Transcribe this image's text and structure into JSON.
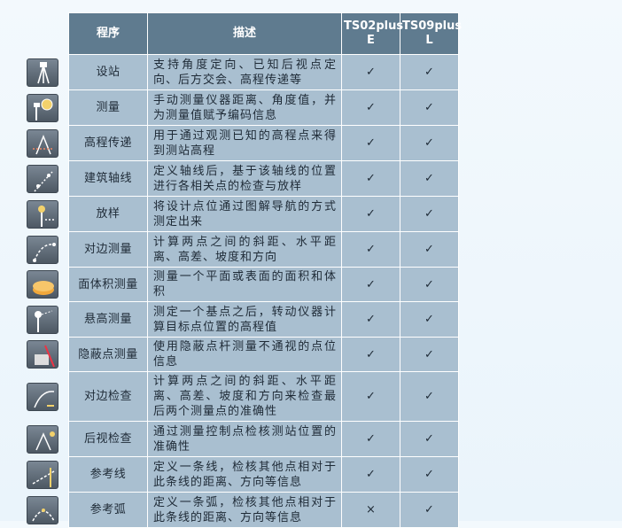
{
  "header": {
    "program": "程序",
    "description": "描述",
    "ts02": "TS02plus E",
    "ts09": "TS09plus L"
  },
  "rows": [
    {
      "name": "设站",
      "desc": "支持角度定向、已知后视点定向、后方交会、高程传递等",
      "ts02": "✓",
      "ts09": "✓",
      "icon": "total-station-setup-icon"
    },
    {
      "name": "测量",
      "desc": "手动测量仪器距离、角度值，并为测量值赋予编码信息",
      "ts02": "✓",
      "ts09": "✓",
      "icon": "survey-prism-icon"
    },
    {
      "name": "高程传递",
      "desc": "用于通过观测已知的高程点来得到测站高程",
      "ts02": "✓",
      "ts09": "✓",
      "icon": "height-transfer-icon"
    },
    {
      "name": "建筑轴线",
      "desc": "定义轴线后，基于该轴线的位置进行各相关点的检查与放样",
      "ts02": "✓",
      "ts09": "✓",
      "icon": "construction-axis-icon"
    },
    {
      "name": "放样",
      "desc": "将设计点位通过图解导航的方式测定出来",
      "ts02": "✓",
      "ts09": "✓",
      "icon": "stakeout-icon"
    },
    {
      "name": "对边测量",
      "desc": "计算两点之间的斜距、水平距离、高差、坡度和方向",
      "ts02": "✓",
      "ts09": "✓",
      "icon": "tie-distance-icon"
    },
    {
      "name": "面体积测量",
      "desc": "测量一个平面或表面的面积和体积",
      "ts02": "✓",
      "ts09": "✓",
      "icon": "area-volume-icon"
    },
    {
      "name": "悬高测量",
      "desc": "测定一个基点之后，转动仪器计算目标点位置的高程值",
      "ts02": "✓",
      "ts09": "✓",
      "icon": "remote-height-icon"
    },
    {
      "name": "隐蔽点测量",
      "desc": "使用隐蔽点杆测量不通视的点位信息",
      "ts02": "✓",
      "ts09": "✓",
      "icon": "hidden-point-icon"
    },
    {
      "name": "对边检查",
      "desc": "计算两点之间的斜距、水平距离、高差、坡度和方向来检查最后两个测量点的准确性",
      "ts02": "✓",
      "ts09": "✓",
      "icon": "tie-distance-check-icon"
    },
    {
      "name": "后视检查",
      "desc": "通过测量控制点检核测站位置的准确性",
      "ts02": "✓",
      "ts09": "✓",
      "icon": "backsight-check-icon"
    },
    {
      "name": "参考线",
      "desc": "定义一条线，检核其他点相对于此条线的距离、方向等信息",
      "ts02": "✓",
      "ts09": "✓",
      "icon": "reference-line-icon"
    },
    {
      "name": "参考弧",
      "desc": "定义一条弧，检核其他点相对于此条线的距离、方向等信息",
      "ts02": "×",
      "ts09": "✓",
      "icon": "reference-arc-icon"
    }
  ]
}
